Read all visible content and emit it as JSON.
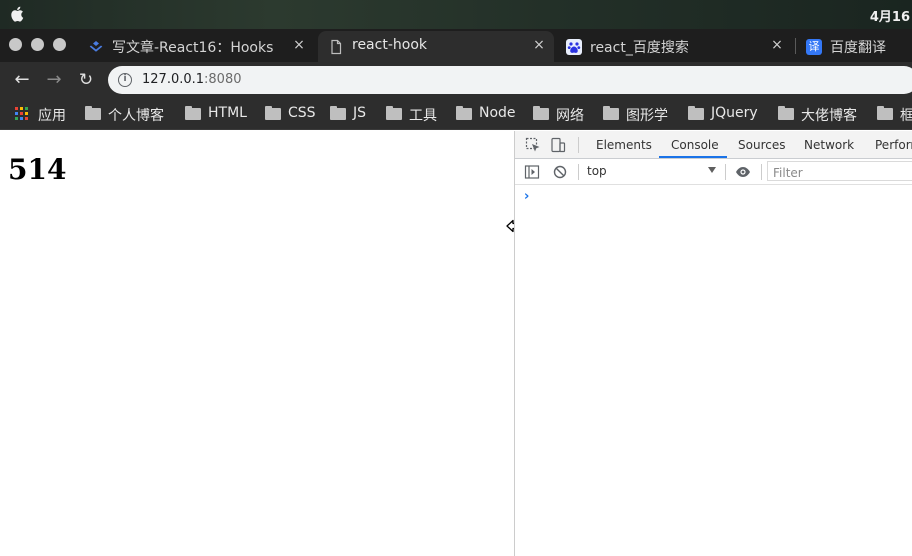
{
  "menubar": {
    "date": "4月16"
  },
  "tabs": [
    {
      "title": "写文章-React16：Hooks",
      "icon": "juejin-icon",
      "close": "×"
    },
    {
      "title": "react-hook",
      "icon": "page-icon",
      "close": "×",
      "active": true
    },
    {
      "title": "react_百度搜索",
      "icon": "baidu-icon",
      "close": "×"
    },
    {
      "title": "百度翻译",
      "icon": "translate-icon",
      "icon_char": "译"
    }
  ],
  "toolbar": {
    "back": "←",
    "forward": "→",
    "reload": "↻",
    "url_host": "127.0.0.1",
    "url_port": ":8080",
    "info_icon": "i"
  },
  "bookmarks": [
    {
      "label": "应用",
      "icon": "apps-grid-icon"
    },
    {
      "label": "个人博客",
      "icon": "folder-icon"
    },
    {
      "label": "HTML",
      "icon": "folder-icon"
    },
    {
      "label": "CSS",
      "icon": "folder-icon"
    },
    {
      "label": "JS",
      "icon": "folder-icon"
    },
    {
      "label": "工具",
      "icon": "folder-icon"
    },
    {
      "label": "Node",
      "icon": "folder-icon"
    },
    {
      "label": "网络",
      "icon": "folder-icon"
    },
    {
      "label": "图形学",
      "icon": "folder-icon"
    },
    {
      "label": "JQuery",
      "icon": "folder-icon"
    },
    {
      "label": "大佬博客",
      "icon": "folder-icon"
    },
    {
      "label": "框",
      "icon": "folder-icon"
    }
  ],
  "page": {
    "heading": "514"
  },
  "devtools": {
    "tabs": [
      "Elements",
      "Console",
      "Sources",
      "Network",
      "Perform"
    ],
    "active_tab": "Console",
    "context": "top",
    "filter_placeholder": "Filter",
    "prompt": "›"
  },
  "colors": {
    "accent": "#1a73e8",
    "chrome_dark": "#2d2d2d",
    "tab_strip": "#1e1e1e"
  }
}
